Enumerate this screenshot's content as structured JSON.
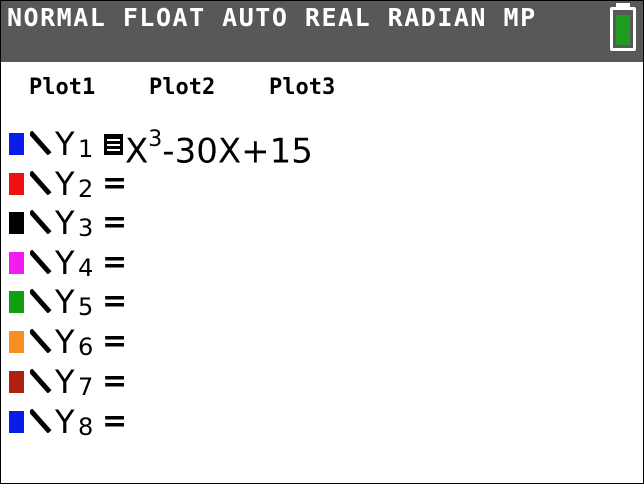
{
  "status_bar": {
    "text": "NORMAL FLOAT AUTO REAL RADIAN MP",
    "battery_color": "#1d9c1d"
  },
  "plots": [
    "Plot1",
    "Plot2",
    "Plot3"
  ],
  "equations": [
    {
      "var": "Y",
      "sub": "1",
      "color": "#0a1de8",
      "selected": true,
      "expr_base": "X",
      "expr_exp": "3",
      "expr_rest": "-30X+15"
    },
    {
      "var": "Y",
      "sub": "2",
      "color": "#f01010",
      "selected": false,
      "eq": "="
    },
    {
      "var": "Y",
      "sub": "3",
      "color": "#000000",
      "selected": false,
      "eq": "="
    },
    {
      "var": "Y",
      "sub": "4",
      "color": "#f01cf0",
      "selected": false,
      "eq": "="
    },
    {
      "var": "Y",
      "sub": "5",
      "color": "#10a010",
      "selected": false,
      "eq": "="
    },
    {
      "var": "Y",
      "sub": "6",
      "color": "#f88f25",
      "selected": false,
      "eq": "="
    },
    {
      "var": "Y",
      "sub": "7",
      "color": "#b02010",
      "selected": false,
      "eq": "="
    },
    {
      "var": "Y",
      "sub": "8",
      "color": "#0a1de8",
      "selected": false,
      "eq": "="
    }
  ]
}
